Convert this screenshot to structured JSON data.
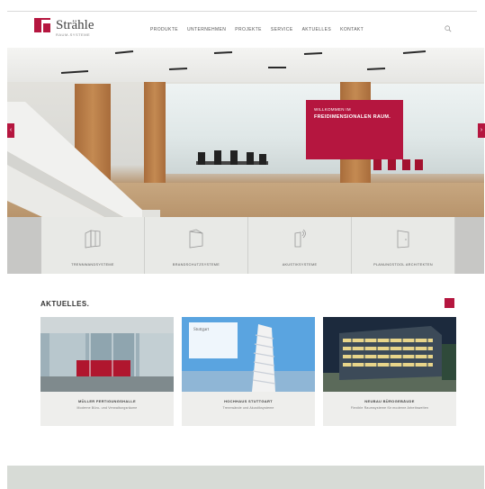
{
  "brand": {
    "name": "Strähle",
    "tagline": "RAUM-SYSTEME",
    "accent": "#b5163f"
  },
  "nav": {
    "items": [
      "PRODUKTE",
      "UNTERNEHMEN",
      "PROJEKTE",
      "SERVICE",
      "AKTUELLES",
      "KONTAKT"
    ]
  },
  "hero": {
    "line1": "WILLKOMMEN IM",
    "line2": "FREIDIMENSIONALEN RAUM."
  },
  "tiles": [
    "TRENNWANDSYSTEME",
    "BRANDSCHUTZSYSTEME",
    "AKUSTIKSYSTEME",
    "PLANUNGSTOOL ARCHITEKTEN"
  ],
  "news": {
    "title": "AKTUELLES.",
    "cards": [
      {
        "title": "MÜLLER FERTIGUNGSHALLE",
        "subtitle": "Moderne Büro- und Verwaltungsräume"
      },
      {
        "title": "HOCHHAUS STUTTGART",
        "subtitle": "Trennwände und Akustiksysteme",
        "overlay": "Stuttgart"
      },
      {
        "title": "NEUBAU BÜROGEBÄUDE",
        "subtitle": "Flexible Raumsysteme für moderne Arbeitswelten"
      }
    ]
  },
  "footer": {
    "title": ""
  }
}
